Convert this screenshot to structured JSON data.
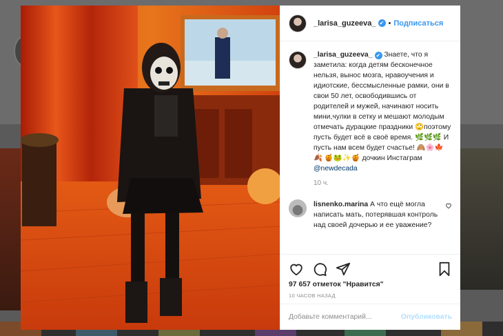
{
  "post": {
    "username": "_larisa_guzeeva_",
    "follow_label": "Подписаться",
    "dot": "•",
    "verified_icon": "✔",
    "caption_text": " Знаете, что я заметила: когда детям бесконечное нельзя, вынос мозга, нравоучения и идиотские, бессмысленные рамки, они в свои 50 лет, освободившись от родителей и мужей, начинают носить мини,чулки в сетку и мешают молодым отмечать дурацкие праздники 🙄поэтому пусть будет всё в своё время. 🌿🌿🌿 И пусть нам всем будет счастье! 🙈🌸🍁🍂 🍯🐸✨🍯 дочкин Инстаграм ",
    "caption_mention": "@newdecada",
    "time_ago": "10 ч."
  },
  "comments": [
    {
      "username": "lisnenko.marina",
      "text": " А что ещё могла написать мать, потерявшая контроль над своей дочерью и ее уважение?"
    }
  ],
  "actions": {
    "likes_text": "97 657 отметок \"Нравится\"",
    "timestamp": "10 ЧАСОВ НАЗАД"
  },
  "add_comment": {
    "placeholder": "Добавьте комментарий...",
    "post_label": "Опубликовать"
  },
  "icons": {
    "like": "heart-icon",
    "comment": "comment-icon",
    "share": "share-icon",
    "save": "bookmark-icon"
  },
  "colors": {
    "link": "#3897f0",
    "post_disabled": "#b2dffc",
    "muted": "#8e8e8e"
  }
}
